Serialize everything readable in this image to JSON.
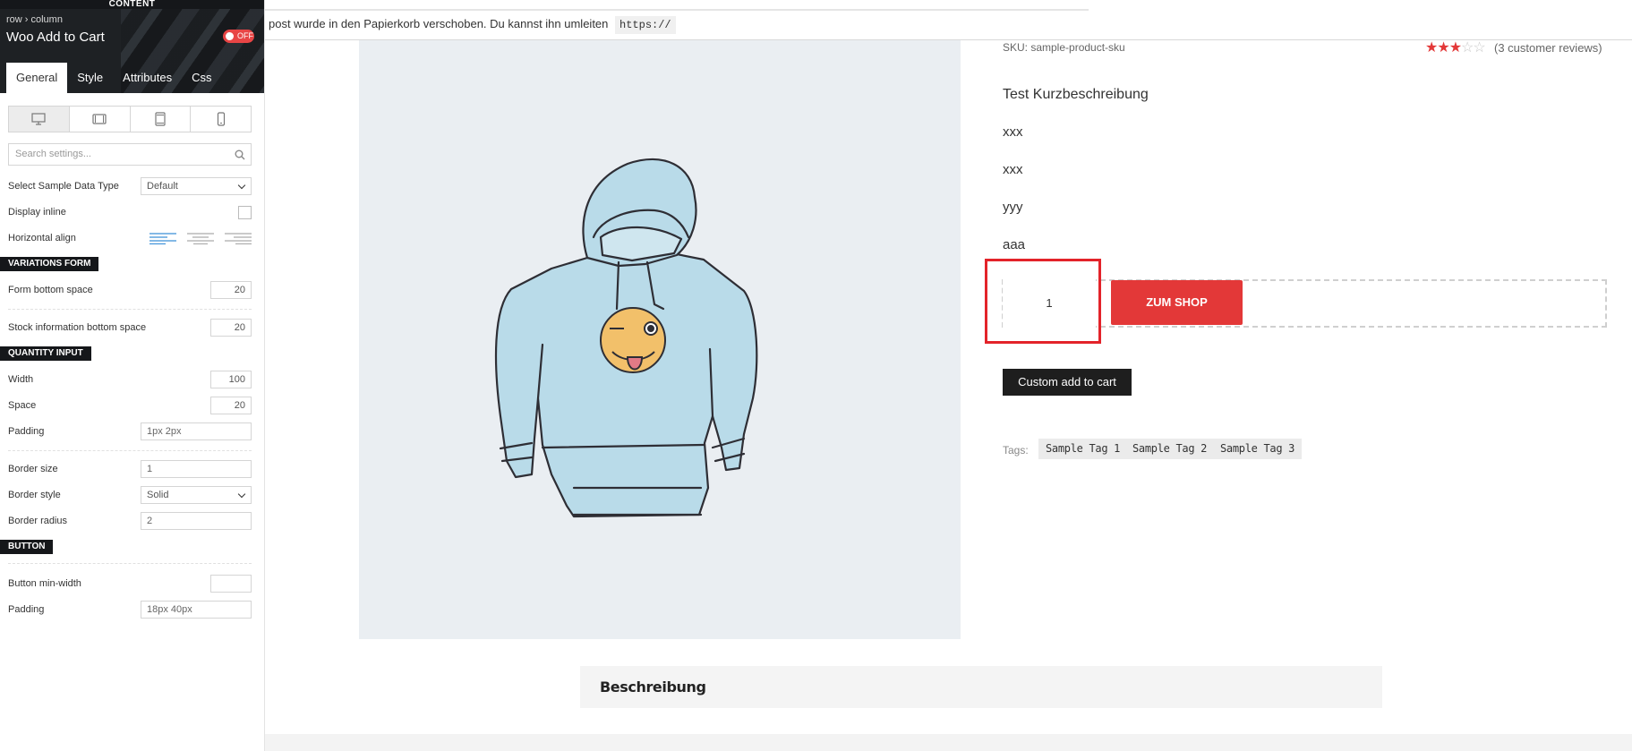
{
  "sidebar": {
    "header_label": "CONTENT",
    "breadcrumb": "row › column",
    "element_title": "Woo Add to Cart",
    "toggle_label": "OFF",
    "tabs": [
      {
        "label": "General"
      },
      {
        "label": "Style"
      },
      {
        "label": "Attributes"
      },
      {
        "label": "Css"
      }
    ],
    "search_placeholder": "Search settings...",
    "fields": {
      "sample_data_type": {
        "label": "Select Sample Data Type",
        "value": "Default"
      },
      "display_inline": {
        "label": "Display inline"
      },
      "horizontal_align": {
        "label": "Horizontal align"
      }
    },
    "sections": {
      "variations_form": "VARIATIONS FORM",
      "quantity_input": "QUANTITY INPUT",
      "button": "BUTTON"
    },
    "variations": {
      "form_bottom_space": {
        "label": "Form bottom space",
        "value": "20"
      },
      "stock_bottom_space": {
        "label": "Stock information bottom space",
        "value": "20"
      }
    },
    "quantity": {
      "width": {
        "label": "Width",
        "value": "100"
      },
      "space": {
        "label": "Space",
        "value": "20"
      },
      "padding": {
        "label": "Padding",
        "value": "1px 2px"
      },
      "border_size": {
        "label": "Border size",
        "value": "1"
      },
      "border_style": {
        "label": "Border style",
        "value": "Solid"
      },
      "border_radius": {
        "label": "Border radius",
        "value": "2"
      }
    },
    "button": {
      "min_width": {
        "label": "Button min-width",
        "value": ""
      },
      "padding": {
        "label": "Padding",
        "value": "18px 40px"
      }
    }
  },
  "notice": {
    "text": "post wurde in den Papierkorb verschoben. Du kannst ihn umleiten",
    "code": "https://"
  },
  "product": {
    "sku": "SKU: sample-product-sku",
    "rating": 3,
    "rating_max": 5,
    "reviews": "(3 customer reviews)",
    "short_description": [
      "Test Kurzbeschreibung",
      "xxx",
      "xxx",
      "yyy",
      "aaa"
    ],
    "quantity": "1",
    "add_button": "ZUM SHOP",
    "custom_button": "Custom add to cart",
    "tags_label": "Tags:",
    "tags": [
      "Sample Tag 1",
      "Sample Tag 2",
      "Sample Tag 3"
    ]
  },
  "tabs": {
    "description": "Beschreibung"
  },
  "colors": {
    "accent_red": "#e33838",
    "highlight_red": "#e3232a",
    "dark": "#1e2124"
  }
}
